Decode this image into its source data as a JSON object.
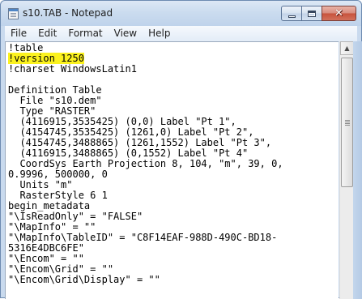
{
  "window": {
    "title": "s10.TAB - Notepad"
  },
  "menu": {
    "items": [
      "File",
      "Edit",
      "Format",
      "View",
      "Help"
    ]
  },
  "editor": {
    "lines": [
      "!table",
      "!version 1250",
      "!charset WindowsLatin1",
      "",
      "Definition Table",
      "  File \"s10.dem\"",
      "  Type \"RASTER\"",
      "  (4116915,3535425) (0,0) Label \"Pt 1\",",
      "  (4154745,3535425) (1261,0) Label \"Pt 2\",",
      "  (4154745,3488865) (1261,1552) Label \"Pt 3\",",
      "  (4116915,3488865) (0,1552) Label \"Pt 4\"",
      "  CoordSys Earth Projection 8, 104, \"m\", 39, 0,",
      "0.9996, 500000, 0",
      "  Units \"m\"",
      "  RasterStyle 6 1",
      "begin_metadata",
      "\"\\IsReadOnly\" = \"FALSE\"",
      "\"\\MapInfo\" = \"\"",
      "\"\\MapInfo\\TableID\" = \"C8F14EAF-988D-490C-BD18-",
      "5316E4DBC6FE\"",
      "\"\\Encom\" = \"\"",
      "\"\\Encom\\Grid\" = \"\"",
      "\"\\Encom\\Grid\\Display\" = \"\""
    ],
    "highlight_color": "#fbf21e"
  },
  "colors": {
    "titlebar": "#c9daee",
    "close_button": "#c7513a"
  }
}
